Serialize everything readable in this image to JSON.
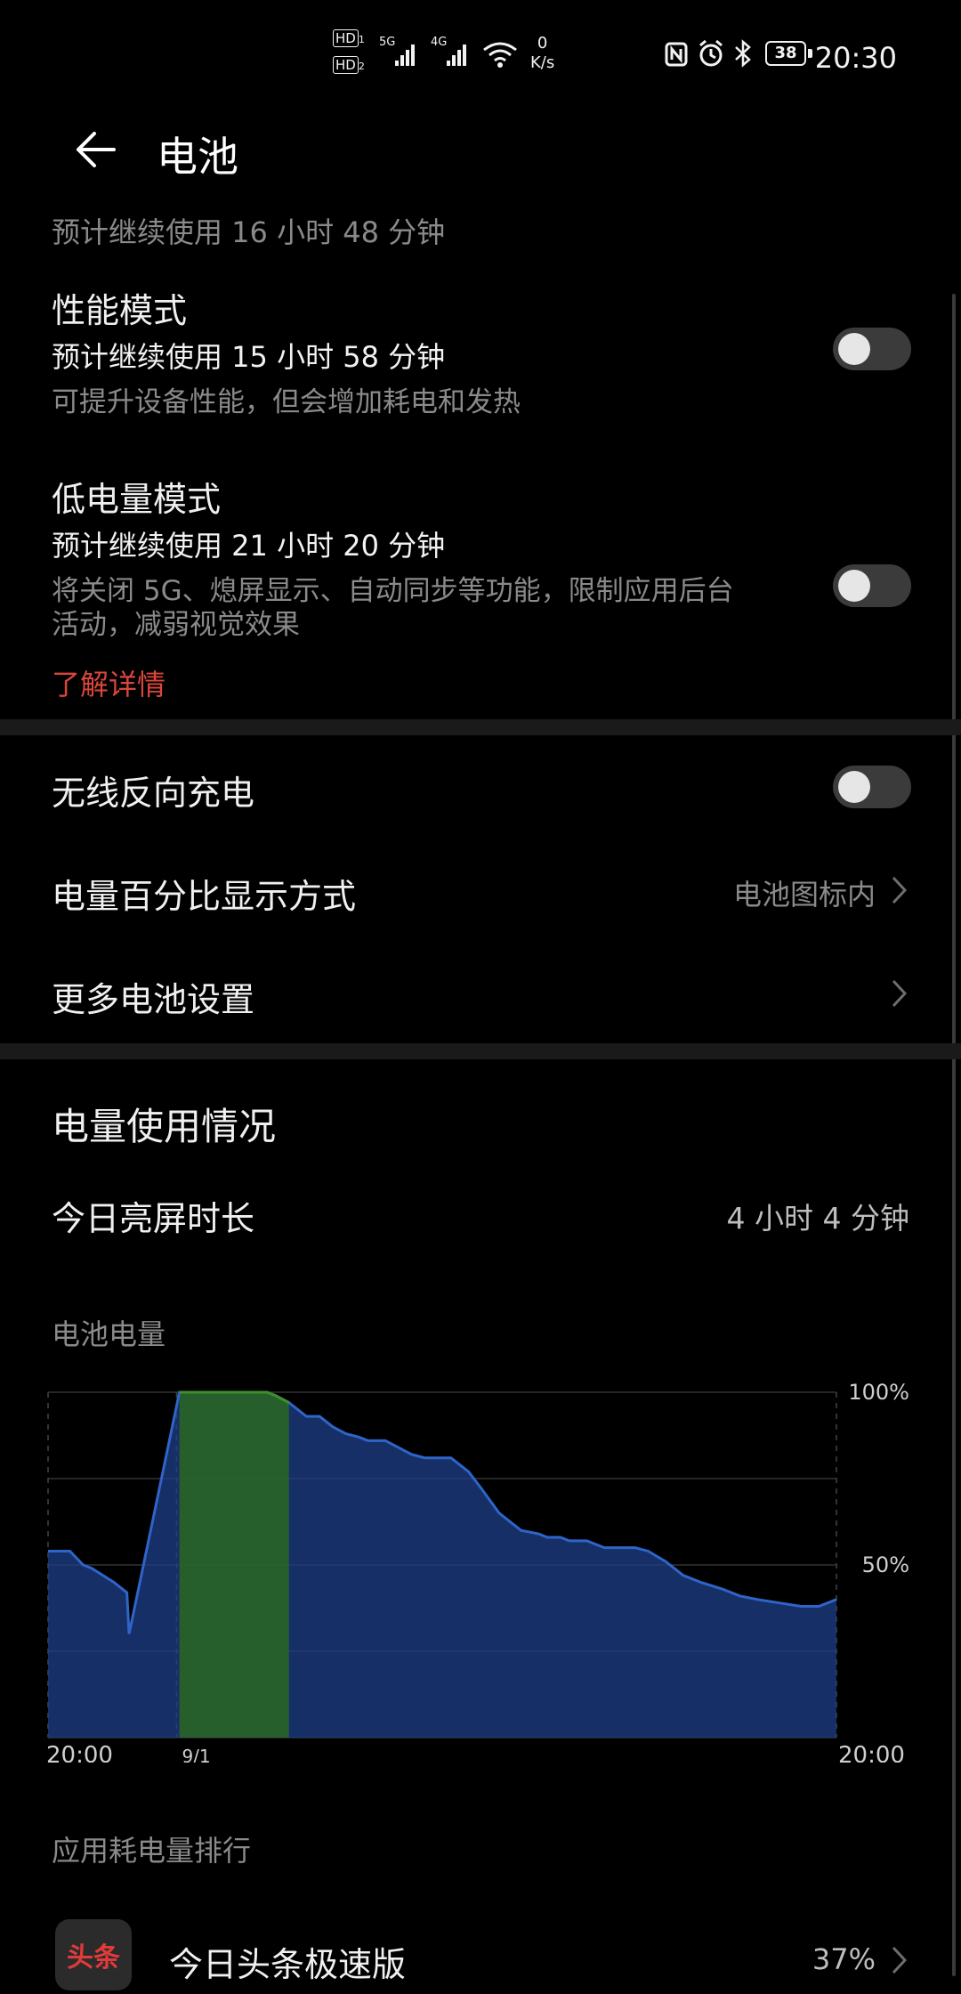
{
  "status_bar": {
    "time": "20:30",
    "speed_value": "0",
    "speed_unit": "K/s",
    "battery_level": "38",
    "sim1": "HD",
    "sim2": "HD",
    "net1": "5G",
    "net2": "4G",
    "icons": [
      "hd-icon",
      "signal-5g-icon",
      "signal-4g-icon",
      "wifi-icon",
      "nfc-icon",
      "alarm-icon",
      "bluetooth-icon",
      "battery-icon"
    ]
  },
  "header": {
    "title": "电池"
  },
  "estimate": {
    "text": "预计继续使用 16 小时 48 分钟"
  },
  "performance_mode": {
    "title": "性能模式",
    "estimate": "预计继续使用 15 小时 58 分钟",
    "description": "可提升设备性能，但会增加耗电和发热"
  },
  "low_power_mode": {
    "title": "低电量模式",
    "estimate": "预计继续使用 21 小时 20 分钟",
    "description_line1": "将关闭 5G、熄屏显示、自动同步等功能，限制应用后台",
    "description_line2": "活动，减弱视觉效果",
    "learn_more": "了解详情",
    "learn_more_color": "#d9463b"
  },
  "settings": {
    "wireless_reverse": "无线反向充电",
    "percent_display": "电量百分比显示方式",
    "percent_display_value": "电池图标内",
    "more_settings": "更多电池设置"
  },
  "usage": {
    "section_title": "电量使用情况",
    "screen_time_label": "今日亮屏时长",
    "screen_time_value": "4 小时 4 分钟",
    "battery_level_label": "电池电量",
    "app_ranking_label": "应用耗电量排行"
  },
  "chart_data": {
    "type": "area",
    "title": "电池电量",
    "x_tick_labels": [
      "20:00",
      "9/1",
      "20:00"
    ],
    "y_tick_labels": [
      "100%",
      "50%"
    ],
    "ylim": [
      0,
      100
    ],
    "grid": true,
    "colors": {
      "discharge": "#1e3f8a",
      "charge": "#2c6b1e",
      "line": "#2f64c9",
      "charge_line": "#3f8f2c"
    },
    "series": [
      {
        "values_x_hours": [
          0,
          1,
          1.6,
          2.0,
          3.0,
          3.6,
          3.7,
          6.0,
          9.0,
          10.0,
          10.4,
          11.0,
          11.8,
          12.4,
          13.0,
          13.6,
          14.2,
          14.6,
          15.4,
          16.6,
          17.2,
          17.8,
          18.4,
          19.2,
          19.8,
          20.6,
          21.6,
          22.4,
          22.8,
          23.4,
          23.8,
          24.6,
          25.4,
          26.8,
          27.4,
          28.2,
          29.0,
          29.8,
          30.8,
          31.6,
          32.4,
          33.4,
          34.4,
          35.2,
          36.0
        ],
        "values_pct": [
          54,
          54,
          50,
          49,
          45,
          42,
          30,
          100,
          100,
          100,
          99,
          97,
          93,
          93,
          90,
          88,
          87,
          86,
          86,
          82,
          81,
          81,
          81,
          77,
          72,
          65,
          60,
          59,
          58,
          58,
          57,
          57,
          55,
          55,
          54,
          51,
          47,
          45,
          43,
          41,
          40,
          39,
          38,
          38,
          40
        ]
      }
    ],
    "charge_segment_x_hours": [
      5.3,
      11.3
    ]
  },
  "apps": [
    {
      "name": "今日头条极速版",
      "percent": "37%",
      "icon_text": "头条"
    }
  ]
}
